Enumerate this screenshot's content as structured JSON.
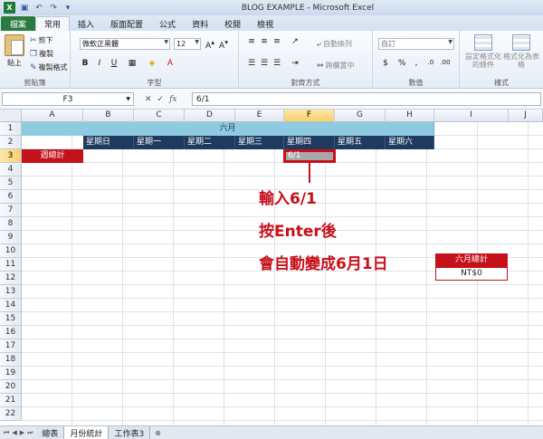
{
  "window": {
    "title": "BLOG EXAMPLE - Microsoft Excel",
    "colors": {
      "accent_red": "#c4111a",
      "header_navy": "#1e3a5e",
      "month_band": "#8fcbe0",
      "file_tab": "#2a7a3e"
    }
  },
  "ribbon": {
    "file_tab": "檔案",
    "tabs": [
      "常用",
      "插入",
      "版面配置",
      "公式",
      "資料",
      "校閱",
      "檢視"
    ],
    "active_tab": "常用",
    "clipboard": {
      "paste": "貼上",
      "cut": "剪下",
      "copy": "複製",
      "format_painter": "複製格式",
      "label": "剪貼簿"
    },
    "font": {
      "name": "微軟正黑體",
      "size": "12",
      "label": "字型"
    },
    "alignment": {
      "wrap": "自動換列",
      "merge": "跨欄置中",
      "label": "對齊方式"
    },
    "number": {
      "format": "自訂",
      "label": "數值"
    },
    "styles": {
      "conditional": "設定格式化的條件",
      "table": "格式化為表格",
      "label": "樣式"
    }
  },
  "formula_bar": {
    "name_box": "F3",
    "fx": "fx",
    "value": "6/1"
  },
  "sheet": {
    "columns": [
      "A",
      "B",
      "C",
      "D",
      "E",
      "F",
      "G",
      "H",
      "I",
      "J"
    ],
    "selected_column": "F",
    "rows": [
      "1",
      "2",
      "3",
      "4",
      "5",
      "6",
      "7",
      "8",
      "9",
      "10",
      "11",
      "12",
      "13",
      "14",
      "15",
      "16",
      "17",
      "18",
      "19",
      "20",
      "21",
      "22"
    ],
    "selected_row": "3",
    "month_title": "六月",
    "weekdays": [
      "星期日",
      "星期一",
      "星期二",
      "星期三",
      "星期四",
      "星期五",
      "星期六"
    ],
    "week_total_label": "週總計",
    "active_cell_value": "6/1",
    "june_total_label": "六月總計",
    "june_total_value": "NT$0"
  },
  "annotation": {
    "line1": "輸入6/1",
    "line2": "按Enter後",
    "line3": "會自動變成6月1日"
  },
  "sheet_tabs": [
    "總表",
    "月份統計",
    "工作表3"
  ]
}
